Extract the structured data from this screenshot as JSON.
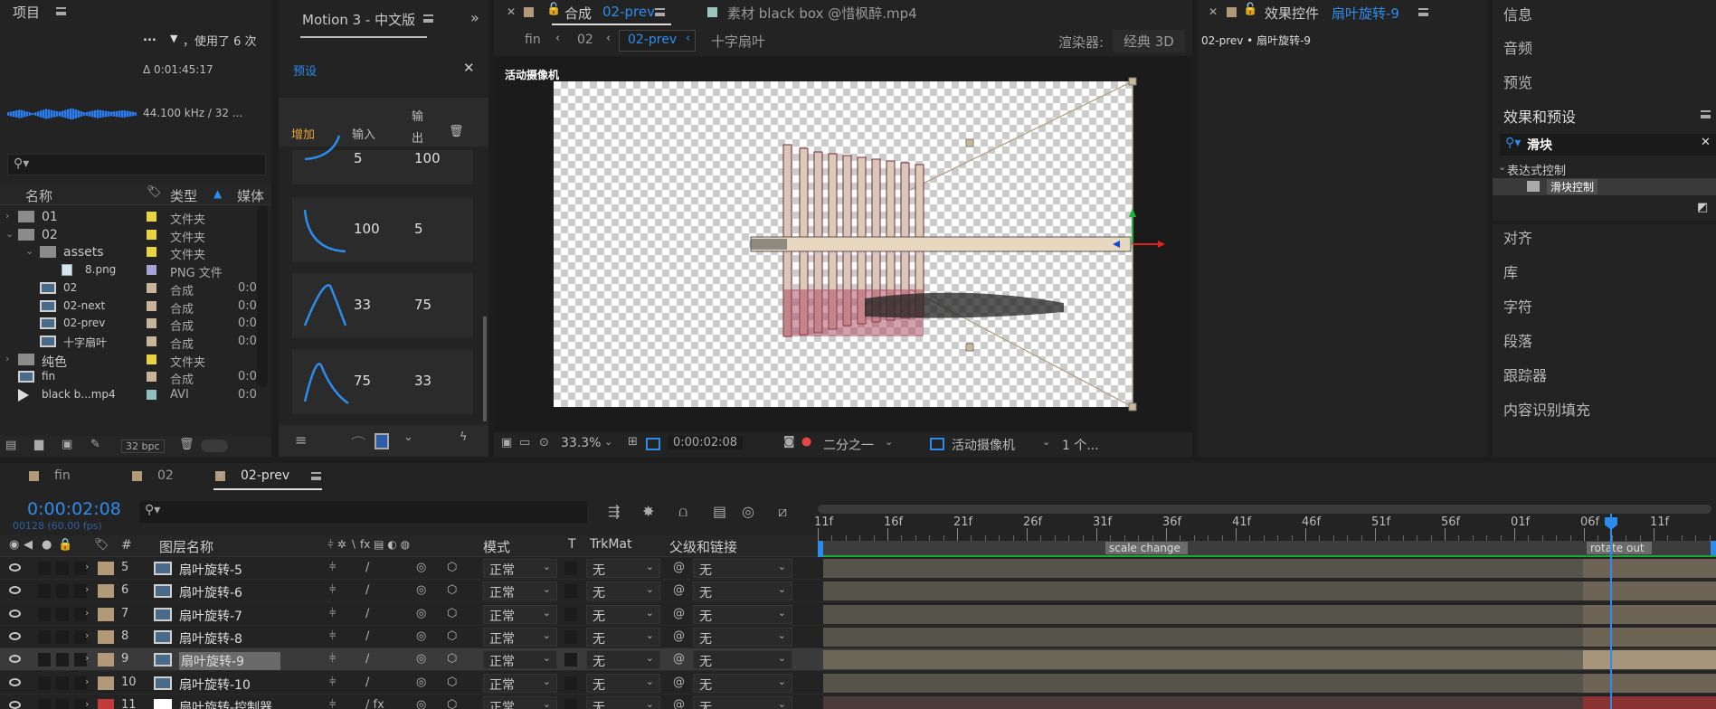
{
  "project": {
    "title": "项目",
    "info_line1": "，使用了 6 次",
    "info_dots": "...",
    "duration": "Δ 0:01:45:17",
    "audio_info": "44.100 kHz / 32 ...",
    "cols": {
      "name": "名称",
      "type": "类型",
      "media": "媒体"
    },
    "rows": [
      {
        "name": "01",
        "type": "文件夹",
        "dur": "",
        "kind": "folder",
        "indent": 0,
        "twirl": "›",
        "label": "#e8d341"
      },
      {
        "name": "02",
        "type": "文件夹",
        "dur": "",
        "kind": "folder",
        "indent": 0,
        "twirl": "⌄",
        "label": "#e8d341"
      },
      {
        "name": "assets",
        "type": "文件夹",
        "dur": "",
        "kind": "folder",
        "indent": 1,
        "twirl": "⌄",
        "label": "#e8d341"
      },
      {
        "name": "8.png",
        "type": "PNG 文件",
        "dur": "",
        "kind": "file",
        "indent": 2,
        "twirl": "",
        "label": "#a7a3d8"
      },
      {
        "name": "02",
        "type": "合成",
        "dur": "0:0",
        "kind": "comp",
        "indent": 1,
        "twirl": "",
        "label": "#c8b49a"
      },
      {
        "name": "02-next",
        "type": "合成",
        "dur": "0:0",
        "kind": "comp",
        "indent": 1,
        "twirl": "",
        "label": "#c8b49a"
      },
      {
        "name": "02-prev",
        "type": "合成",
        "dur": "0:0",
        "kind": "comp",
        "indent": 1,
        "twirl": "",
        "label": "#c8b49a"
      },
      {
        "name": "十字扇叶",
        "type": "合成",
        "dur": "0:0",
        "kind": "comp",
        "indent": 1,
        "twirl": "",
        "label": "#c8b49a"
      },
      {
        "name": "纯色",
        "type": "文件夹",
        "dur": "",
        "kind": "folder",
        "indent": 0,
        "twirl": "›",
        "label": "#e8d341"
      },
      {
        "name": "fin",
        "type": "合成",
        "dur": "0:0",
        "kind": "comp",
        "indent": 0,
        "twirl": "",
        "label": "#c8b49a"
      },
      {
        "name": "black b...mp4",
        "type": "AVI",
        "dur": "0:0",
        "kind": "video",
        "indent": 0,
        "twirl": "",
        "label": "#8fbfbf"
      }
    ],
    "bpc": "32 bpc"
  },
  "motion": {
    "title": "Motion 3 - 中文版",
    "preset_tab": "预设",
    "tabs": [
      "增加",
      "输入",
      "输\n出"
    ],
    "cards": [
      {
        "a": "5",
        "b": "100"
      },
      {
        "a": "100",
        "b": "5"
      },
      {
        "a": "33",
        "b": "75"
      },
      {
        "a": "75",
        "b": "33"
      }
    ]
  },
  "comp": {
    "tab_comp": "合成",
    "tab_comp_name": "02-prev",
    "tab_footage": "素材 black box @惜枫醉.mp4",
    "crumbs": [
      "fin",
      "02",
      "02-prev",
      "十字扇叶"
    ],
    "renderer_label": "渲染器:",
    "renderer_value": "经典 3D",
    "camera_label": "活动摄像机",
    "zoom": "33.3%",
    "time": "0:00:02:08",
    "resolution": "二分之一",
    "view": "活动摄像机",
    "views": "1 个..."
  },
  "effects": {
    "tab": "效果控件",
    "layer": "扇叶旋转-9",
    "path": "02-prev • 扇叶旋转-9"
  },
  "right": {
    "info": "信息",
    "audio": "音频",
    "preview": "预览",
    "fx_presets": "效果和预设",
    "search_value": "滑块",
    "category": "表达式控制",
    "item": "滑块控制",
    "items": [
      "对齐",
      "库",
      "字符",
      "段落",
      "跟踪器",
      "内容识别填充"
    ]
  },
  "timeline": {
    "tabs": [
      "fin",
      "02",
      "02-prev"
    ],
    "timecode": "0:00:02:08",
    "fps": "00128 (60.00 fps)",
    "ruler": [
      "11f",
      "16f",
      "21f",
      "26f",
      "31f",
      "36f",
      "41f",
      "46f",
      "51f",
      "56f",
      "01f",
      "06f",
      "11f"
    ],
    "markers": [
      "scale change",
      "rotate out"
    ],
    "headers": {
      "num": "#",
      "name": "图层名称",
      "mode": "模式",
      "t": "T",
      "trkmat": "TrkMat",
      "parent": "父级和链接"
    },
    "layers": [
      {
        "num": "5",
        "name": "扇叶旋转-5",
        "mode": "正常",
        "trk": "无",
        "parent": "无",
        "label": "#b29a78",
        "selected": false
      },
      {
        "num": "6",
        "name": "扇叶旋转-6",
        "mode": "正常",
        "trk": "无",
        "parent": "无",
        "label": "#b29a78",
        "selected": false
      },
      {
        "num": "7",
        "name": "扇叶旋转-7",
        "mode": "正常",
        "trk": "无",
        "parent": "无",
        "label": "#b29a78",
        "selected": false
      },
      {
        "num": "8",
        "name": "扇叶旋转-8",
        "mode": "正常",
        "trk": "无",
        "parent": "无",
        "label": "#b29a78",
        "selected": false
      },
      {
        "num": "9",
        "name": "扇叶旋转-9",
        "mode": "正常",
        "trk": "无",
        "parent": "无",
        "label": "#b29a78",
        "selected": true
      },
      {
        "num": "10",
        "name": "扇叶旋转-10",
        "mode": "正常",
        "trk": "无",
        "parent": "无",
        "label": "#b29a78",
        "selected": false
      },
      {
        "num": "11",
        "name": "扇叶旋转-控制器",
        "mode": "正常",
        "trk": "无",
        "parent": "无",
        "label": "#c23a3a",
        "selected": false
      }
    ]
  },
  "colors": {
    "accent": "#2d8ceb",
    "active_tab": "#e8a33d"
  }
}
